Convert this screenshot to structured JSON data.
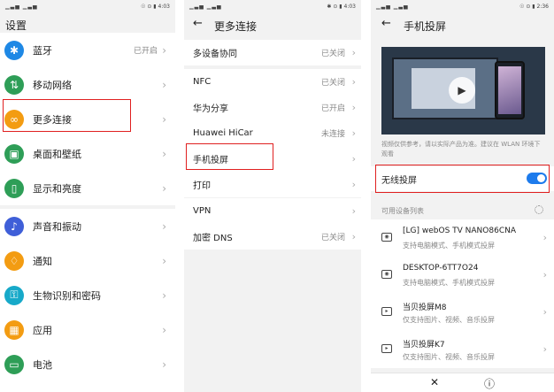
{
  "panel1": {
    "status": {
      "signal": "▁▃▅ ▁▃▅",
      "icons": "☉ ⊙ ▮",
      "time": "4:03"
    },
    "title": "设置",
    "rows": [
      {
        "label": "蓝牙",
        "value": "已开启",
        "icon": "bluetooth-icon",
        "color": "#1e88e5",
        "glyph": "✱"
      },
      {
        "label": "移动网络",
        "value": "",
        "icon": "mobile-network-icon",
        "color": "#2e9e57",
        "glyph": "⇅"
      },
      {
        "label": "更多连接",
        "value": "",
        "icon": "link-icon",
        "color": "#f39c12",
        "glyph": "∞"
      },
      {
        "label": "桌面和壁纸",
        "value": "",
        "icon": "wallpaper-icon",
        "color": "#2e9e57",
        "glyph": "▣"
      },
      {
        "label": "显示和亮度",
        "value": "",
        "icon": "display-icon",
        "color": "#2e9e57",
        "glyph": "▯"
      },
      {
        "label": "声音和振动",
        "value": "",
        "icon": "sound-icon",
        "color": "#3f5fd8",
        "glyph": "♪"
      },
      {
        "label": "通知",
        "value": "",
        "icon": "bell-icon",
        "color": "#f39c12",
        "glyph": "♢"
      },
      {
        "label": "生物识别和密码",
        "value": "",
        "icon": "key-icon",
        "color": "#17a9c9",
        "glyph": "⚿"
      },
      {
        "label": "应用",
        "value": "",
        "icon": "apps-icon",
        "color": "#f39c12",
        "glyph": "▦"
      },
      {
        "label": "电池",
        "value": "",
        "icon": "battery-icon",
        "color": "#2e9e57",
        "glyph": "▭"
      }
    ]
  },
  "panel2": {
    "status": {
      "signal": "▁▃▅ ▁▃▅",
      "icons": "✱ ⊙ ▮",
      "time": "4:03"
    },
    "back": "←",
    "title": "更多连接",
    "group1": [
      {
        "label": "多设备协同",
        "value": "已关闭"
      }
    ],
    "group2": [
      {
        "label": "NFC",
        "value": "已关闭"
      },
      {
        "label": "华为分享",
        "value": "已开启"
      },
      {
        "label": "Huawei HiCar",
        "value": "未连接"
      },
      {
        "label": "手机投屏",
        "value": ""
      },
      {
        "label": "打印",
        "value": ""
      }
    ],
    "group3": [
      {
        "label": "VPN",
        "value": ""
      },
      {
        "label": "加密 DNS",
        "value": "已关闭"
      }
    ]
  },
  "panel3": {
    "status": {
      "signal": "▁▃▅ ▁▃▅",
      "icons": "☉ ⊙ ▮",
      "time": "2:36"
    },
    "back": "←",
    "title": "手机投屏",
    "note": "视频仅供参考，请以实际产品为准。建议在 WLAN 环境下观看",
    "wireless_label": "无线投屏",
    "wireless_on": true,
    "devices_header": "可用设备列表",
    "devices": [
      {
        "name": "[LG] webOS TV NANO86CNA",
        "desc": "支持电脑模式、手机模式投屏"
      },
      {
        "name": "DESKTOP-6TT7O24",
        "desc": "支持电脑模式、手机模式投屏"
      },
      {
        "name": "当贝投屏M8",
        "desc": "仅支持图片、视频、音乐投屏"
      },
      {
        "name": "当贝投屏K7",
        "desc": "仅支持图片、视频、音乐投屏"
      }
    ],
    "bottom_close": "✕",
    "bottom_info": "ⓘ",
    "play": "▶"
  },
  "colors": {
    "accent": "#1d7bec",
    "highlight": "#e02020"
  }
}
